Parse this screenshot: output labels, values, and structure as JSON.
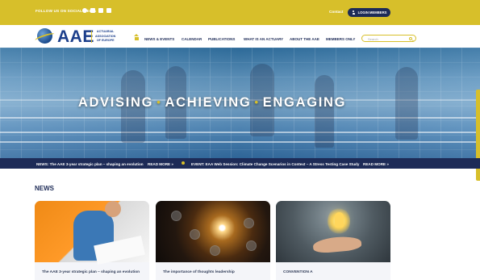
{
  "topbar": {
    "social_text": "FOLLOW US ON SOCIAL MEDIA",
    "contact": "Contact",
    "login": "LOGIN MEMBERS",
    "social_icons": [
      "social-circle-icon",
      "x-icon",
      "linkedin-icon",
      "mail-icon"
    ],
    "accent_color": "#d7bf2a"
  },
  "header": {
    "logo": "AAE",
    "logo_sub_lines": [
      "ACTUARIAL",
      "ASSOCIATION",
      "OF EUROPE"
    ],
    "nav": [
      {
        "label": "NEWS & EVENTS"
      },
      {
        "label": "CALENDAR"
      },
      {
        "label": "PUBLICATIONS"
      },
      {
        "label": "WHAT IS AN ACTUARY"
      },
      {
        "label": "ABOUT THE AAE"
      },
      {
        "label": "MEMBERS ONLY"
      }
    ],
    "search_placeholder": "Search",
    "home_icon": "home-icon"
  },
  "hero": {
    "words": [
      "ADVISING",
      "ACHIEVING",
      "ENGAGING"
    ],
    "separator": "•"
  },
  "ticker": {
    "items": [
      {
        "text": "NEWS: The AAE 3-year strategic plan – shaping an evolution",
        "cta": "READ MORE »"
      },
      {
        "text": "EVENT: EAA Web Session: Climate Change Scenarios in Context – A Stress Testing Case Study",
        "cta": "READ MORE »"
      }
    ]
  },
  "news": {
    "heading": "NEWS",
    "cards": [
      {
        "title": "The AAE 3-year strategic plan – shaping an evolution",
        "subtitle": ""
      },
      {
        "title": "The importance of thoughts leadership",
        "subtitle": ""
      },
      {
        "title": "CONVENTION A",
        "subtitle": ""
      }
    ]
  }
}
